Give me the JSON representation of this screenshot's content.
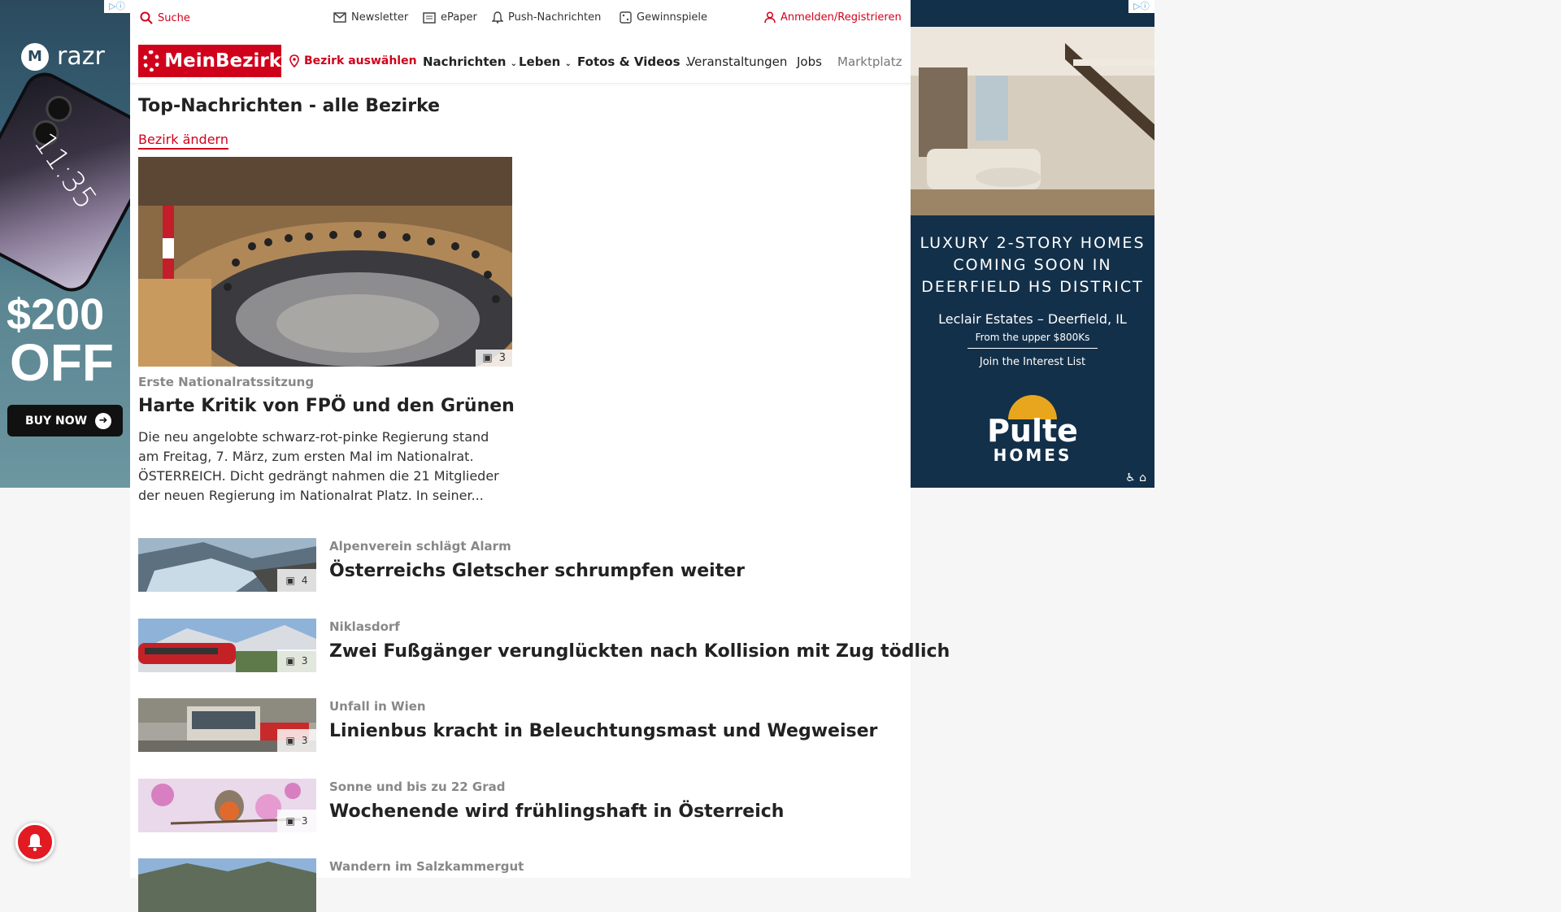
{
  "left_ad": {
    "adchoice": "▷ⓘ",
    "brand": "razr",
    "phone_time": "11:35",
    "amount": "$200",
    "off": "OFF",
    "cta": "BUY NOW"
  },
  "topbar": {
    "search": "Suche",
    "newsletter": "Newsletter",
    "epaper": "ePaper",
    "push": "Push-Nachrichten",
    "gewinnspiele": "Gewinnspiele",
    "login": "Anmelden/Registrieren"
  },
  "nav": {
    "logo": "MeinBezirk",
    "bezirk": "Bezirk auswählen",
    "items": [
      "Nachrichten",
      "Leben",
      "Fotos & Videos",
      "Veranstaltungen",
      "Jobs",
      "Marktplatz"
    ]
  },
  "section": {
    "title": "Top-Nachrichten - alle Bezirke",
    "change": "Bezirk ändern"
  },
  "hero": {
    "photo_count": "3",
    "kicker": "Erste Nationalratssitzung",
    "title": "Harte Kritik von FPÖ und den Grünen",
    "text": "Die neu angelobte schwarz-rot-pinke Regierung stand am Freitag, 7. März, zum ersten Mal im Nationalrat. ÖSTERREICH. Dicht gedrängt nahmen die 21 Mitglieder der neuen Regierung im Nationalrat Platz. In seiner..."
  },
  "articles": [
    {
      "kicker": "Alpenverein schlägt Alarm",
      "title": "Österreichs Gletscher schrumpfen weiter",
      "count": "4"
    },
    {
      "kicker": "Niklasdorf",
      "title": "Zwei Fußgänger verunglückten nach Kollision mit Zug tödlich",
      "count": "3"
    },
    {
      "kicker": "Unfall in Wien",
      "title": "Linienbus kracht in Beleuchtungsmast und Wegweiser",
      "count": "3"
    },
    {
      "kicker": "Sonne und bis zu 22 Grad",
      "title": "Wochenende wird frühlingshaft in Österreich",
      "count": "3"
    },
    {
      "kicker": "Wandern im Salzkammergut",
      "title": "",
      "count": ""
    }
  ],
  "right_ad": {
    "adchoice": "▷ⓘ",
    "headline_1": "LUXURY 2-STORY HOMES",
    "headline_2": "COMING SOON IN",
    "headline_3": "DEERFIELD HS DISTRICT",
    "location": "Leclair Estates – Deerfield, IL",
    "price": "From the upper $800Ks",
    "cta": "Join the Interest List",
    "brand": "Pulte",
    "brand_sub": "HOMES"
  },
  "colors": {
    "brand_red": "#d0021b",
    "ad_navy": "#13304a"
  }
}
